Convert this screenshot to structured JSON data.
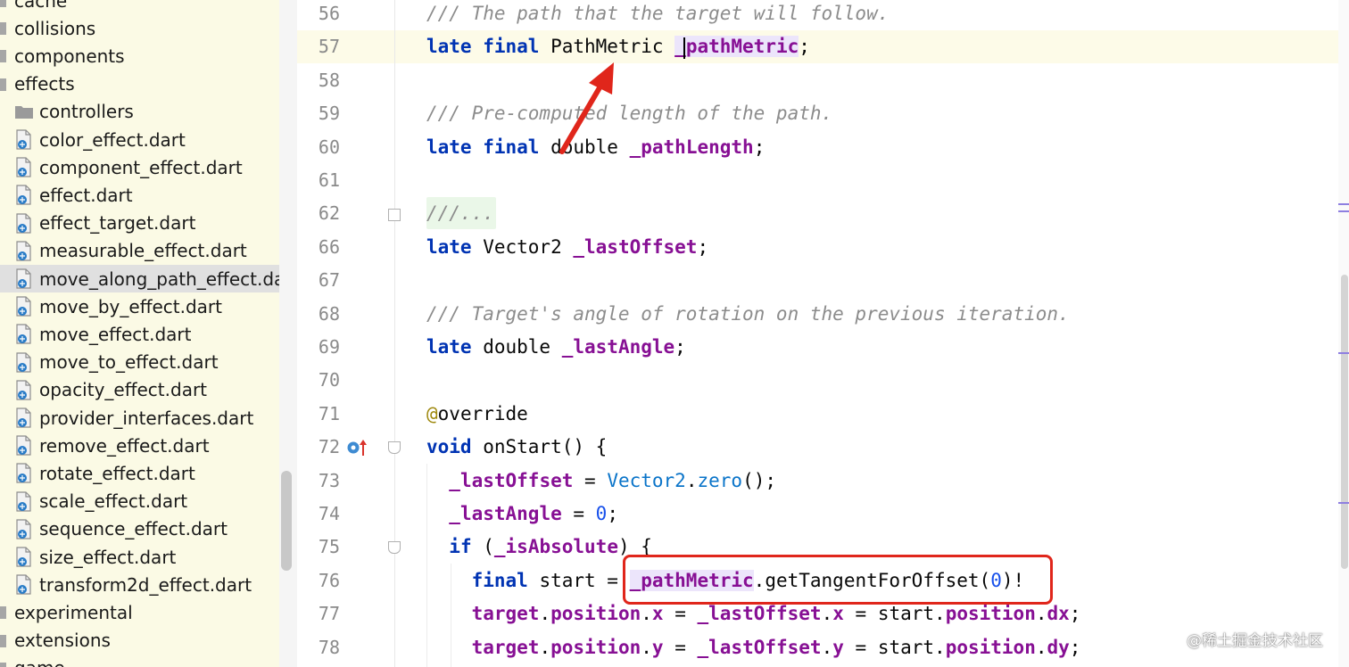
{
  "tree": {
    "items": [
      {
        "label": "cache",
        "kind": "folder",
        "level": 0
      },
      {
        "label": "collisions",
        "kind": "folder",
        "level": 0
      },
      {
        "label": "components",
        "kind": "folder",
        "level": 0
      },
      {
        "label": "effects",
        "kind": "folder",
        "level": 0
      },
      {
        "label": "controllers",
        "kind": "folder",
        "level": 1
      },
      {
        "label": "color_effect.dart",
        "kind": "dart-file",
        "level": 1
      },
      {
        "label": "component_effect.dart",
        "kind": "dart-file",
        "level": 1
      },
      {
        "label": "effect.dart",
        "kind": "dart-file",
        "level": 1
      },
      {
        "label": "effect_target.dart",
        "kind": "dart-file",
        "level": 1
      },
      {
        "label": "measurable_effect.dart",
        "kind": "dart-file",
        "level": 1
      },
      {
        "label": "move_along_path_effect.da",
        "kind": "dart-file",
        "level": 1,
        "selected": true
      },
      {
        "label": "move_by_effect.dart",
        "kind": "dart-file",
        "level": 1
      },
      {
        "label": "move_effect.dart",
        "kind": "dart-file",
        "level": 1
      },
      {
        "label": "move_to_effect.dart",
        "kind": "dart-file",
        "level": 1
      },
      {
        "label": "opacity_effect.dart",
        "kind": "dart-file",
        "level": 1
      },
      {
        "label": "provider_interfaces.dart",
        "kind": "dart-file",
        "level": 1
      },
      {
        "label": "remove_effect.dart",
        "kind": "dart-file",
        "level": 1
      },
      {
        "label": "rotate_effect.dart",
        "kind": "dart-file",
        "level": 1
      },
      {
        "label": "scale_effect.dart",
        "kind": "dart-file",
        "level": 1
      },
      {
        "label": "sequence_effect.dart",
        "kind": "dart-file",
        "level": 1
      },
      {
        "label": "size_effect.dart",
        "kind": "dart-file",
        "level": 1
      },
      {
        "label": "transform2d_effect.dart",
        "kind": "dart-file",
        "level": 1
      },
      {
        "label": "experimental",
        "kind": "folder",
        "level": 0
      },
      {
        "label": "extensions",
        "kind": "folder",
        "level": 0
      },
      {
        "label": "game",
        "kind": "folder",
        "level": 0
      }
    ]
  },
  "editor": {
    "lines": [
      {
        "n": "56",
        "parts": [
          [
            "cmt",
            "/// The path that the target will follow."
          ]
        ]
      },
      {
        "n": "57",
        "parts": [
          [
            "kw",
            "late"
          ],
          [
            "",
            "' '"
          ],
          [
            "kw",
            "final"
          ],
          [
            "",
            " PathMetric "
          ],
          [
            "fld hl",
            "_pathMetric"
          ],
          [
            "",
            ";"
          ]
        ]
      },
      {
        "n": "58",
        "parts": []
      },
      {
        "n": "59",
        "parts": [
          [
            "cmt",
            "/// Pre-computed length of the path."
          ]
        ]
      },
      {
        "n": "60",
        "parts": [
          [
            "kw",
            "late"
          ],
          [
            "",
            " "
          ],
          [
            "kw",
            "final"
          ],
          [
            "",
            " double "
          ],
          [
            "fld",
            "_pathLength"
          ],
          [
            "",
            ";"
          ]
        ]
      },
      {
        "n": "61",
        "parts": []
      },
      {
        "n": "62",
        "parts": [
          [
            "cmt",
            "///..."
          ]
        ]
      },
      {
        "n": "66",
        "parts": [
          [
            "kw",
            "late"
          ],
          [
            "",
            " Vector2 "
          ],
          [
            "fld",
            "_lastOffset"
          ],
          [
            "",
            ";"
          ]
        ]
      },
      {
        "n": "67",
        "parts": []
      },
      {
        "n": "68",
        "parts": [
          [
            "cmt",
            "/// Target's angle of rotation on the previous iteration."
          ]
        ]
      },
      {
        "n": "69",
        "parts": [
          [
            "kw",
            "late"
          ],
          [
            "",
            " double "
          ],
          [
            "fld",
            "_lastAngle"
          ],
          [
            "",
            ";"
          ]
        ]
      },
      {
        "n": "70",
        "parts": []
      },
      {
        "n": "71",
        "parts": [
          [
            "ann",
            "@"
          ],
          [
            "",
            "override"
          ]
        ]
      },
      {
        "n": "72",
        "parts": [
          [
            "kw",
            "void"
          ],
          [
            "",
            " onStart() {"
          ]
        ]
      },
      {
        "n": "73",
        "parts": [
          [
            "",
            "  "
          ],
          [
            "fld",
            "_lastOffset"
          ],
          [
            "",
            " = "
          ],
          [
            "cls",
            "Vector2"
          ],
          [
            "",
            "."
          ],
          [
            "cls",
            "zero"
          ],
          [
            "",
            "();"
          ]
        ]
      },
      {
        "n": "74",
        "parts": [
          [
            "",
            "  "
          ],
          [
            "fld",
            "_lastAngle"
          ],
          [
            "",
            " = "
          ],
          [
            "num",
            "0"
          ],
          [
            "",
            ";"
          ]
        ]
      },
      {
        "n": "75",
        "parts": [
          [
            "",
            "  "
          ],
          [
            "kw",
            "if"
          ],
          [
            "",
            " ("
          ],
          [
            "fld",
            "_isAbsolute"
          ],
          [
            "",
            ") {"
          ]
        ]
      },
      {
        "n": "76",
        "parts": [
          [
            "",
            "    "
          ],
          [
            "kw",
            "final"
          ],
          [
            "",
            " start = "
          ],
          [
            "fld hl",
            "_pathMetric"
          ],
          [
            "",
            ".getTangentForOffset("
          ],
          [
            "num",
            "0"
          ],
          [
            "",
            ")!"
          ]
        ]
      },
      {
        "n": "77",
        "parts": [
          [
            "",
            "    "
          ],
          [
            "fld",
            "target"
          ],
          [
            "",
            "."
          ],
          [
            "fld",
            "position"
          ],
          [
            "",
            "."
          ],
          [
            "fld",
            "x"
          ],
          [
            "",
            " = "
          ],
          [
            "fld",
            "_lastOffset"
          ],
          [
            "",
            "."
          ],
          [
            "fld",
            "x"
          ],
          [
            "",
            " = start."
          ],
          [
            "fld",
            "position"
          ],
          [
            "",
            "."
          ],
          [
            "fld",
            "dx"
          ],
          [
            "",
            ";"
          ]
        ]
      },
      {
        "n": "78",
        "parts": [
          [
            "",
            "    "
          ],
          [
            "fld",
            "target"
          ],
          [
            "",
            "."
          ],
          [
            "fld",
            "position"
          ],
          [
            "",
            "."
          ],
          [
            "fld",
            "y"
          ],
          [
            "",
            " = "
          ],
          [
            "fld",
            "_lastOffset"
          ],
          [
            "",
            "."
          ],
          [
            "fld",
            "y"
          ],
          [
            "",
            " = start."
          ],
          [
            "fld",
            "position"
          ],
          [
            "",
            "."
          ],
          [
            "fld",
            "dy"
          ],
          [
            "",
            ";"
          ]
        ]
      }
    ]
  },
  "watermark": "@稀土掘金技术社区"
}
